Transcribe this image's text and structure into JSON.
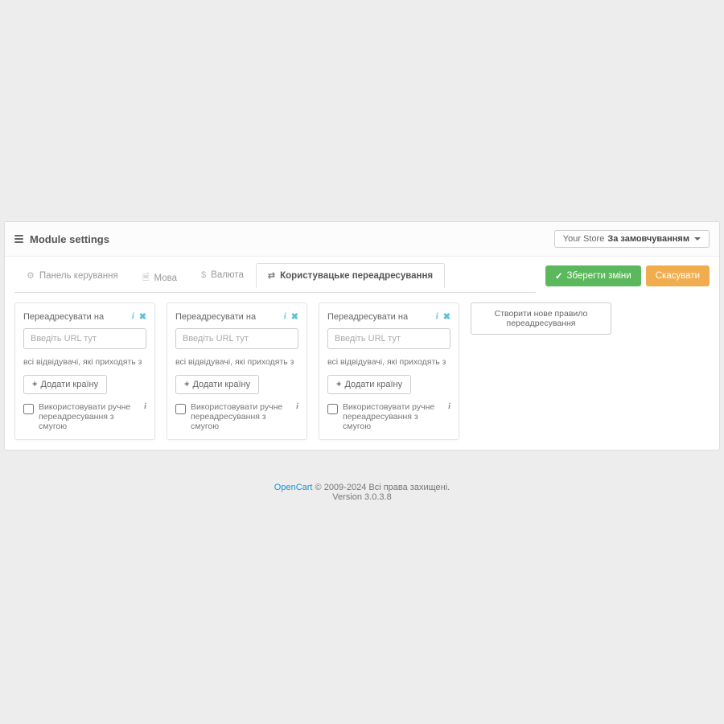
{
  "panel": {
    "title": "Module settings",
    "store_prefix": "Your Store",
    "store_selected": "За замовчуванням"
  },
  "tabs": [
    {
      "icon": "⚙",
      "label": "Панель керування"
    },
    {
      "icon": "🗎",
      "label": "Мова"
    },
    {
      "icon": "$",
      "label": "Валюта"
    },
    {
      "icon": "⇄",
      "label": "Користувацьке переадресування"
    }
  ],
  "actions": {
    "save": "Зберегти зміни",
    "cancel": "Скасувати"
  },
  "card": {
    "redirect_label": "Переадресувати на",
    "url_placeholder": "Введіть URL тут",
    "visitors_label": "всі відвідувачі, які приходять з",
    "add_country": "Додати країну",
    "manual_redirect": "Використовувати ручне переадресування з смугою"
  },
  "create_button": "Створити нове правило переадресування",
  "footer": {
    "brand": "OpenCart",
    "copyright": " © 2009-2024 Всі права захищені.",
    "version": "Version 3.0.3.8"
  }
}
